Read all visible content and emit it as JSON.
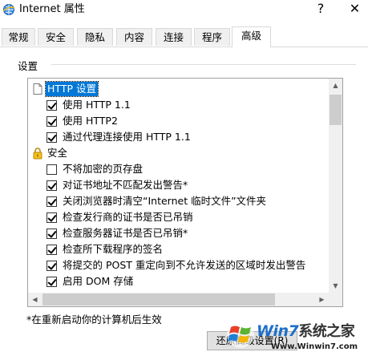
{
  "window": {
    "title": "Internet 属性",
    "help_glyph": "?",
    "close_glyph": "✕"
  },
  "tabs": [
    {
      "label": "常规",
      "active": false
    },
    {
      "label": "安全",
      "active": false
    },
    {
      "label": "隐私",
      "active": false
    },
    {
      "label": "内容",
      "active": false
    },
    {
      "label": "连接",
      "active": false
    },
    {
      "label": "程序",
      "active": false
    },
    {
      "label": "高级",
      "active": true
    }
  ],
  "settings": {
    "group_label": "设置",
    "list": [
      {
        "type": "category",
        "icon": "page-icon",
        "label": "HTTP 设置",
        "selected": true
      },
      {
        "type": "item",
        "checked": true,
        "label": "使用 HTTP 1.1"
      },
      {
        "type": "item",
        "checked": true,
        "label": "使用 HTTP2"
      },
      {
        "type": "item",
        "checked": true,
        "label": "通过代理连接使用 HTTP 1.1"
      },
      {
        "type": "category",
        "icon": "lock-icon",
        "label": "安全",
        "selected": false
      },
      {
        "type": "item",
        "checked": false,
        "label": "不将加密的页存盘"
      },
      {
        "type": "item",
        "checked": true,
        "label": "对证书地址不匹配发出警告*"
      },
      {
        "type": "item",
        "checked": true,
        "label": "关闭浏览器时清空“Internet 临时文件”文件夹"
      },
      {
        "type": "item",
        "checked": true,
        "label": "检查发行商的证书是否已吊销"
      },
      {
        "type": "item",
        "checked": true,
        "label": "检查服务器证书是否已吊销*"
      },
      {
        "type": "item",
        "checked": true,
        "label": "检查所下载程序的签名"
      },
      {
        "type": "item",
        "checked": true,
        "label": "将提交的 POST 重定向到不允许发送的区域时发出警告"
      },
      {
        "type": "item",
        "checked": true,
        "label": "启用 DOM 存储"
      }
    ],
    "note": "*在重新启动你的计算机后生效",
    "restore_button": "还原高级设置(R)"
  },
  "watermark": {
    "brand_main": "Win7",
    "brand_suffix": "系统之家",
    "url": "Www.Winwin7.com"
  }
}
